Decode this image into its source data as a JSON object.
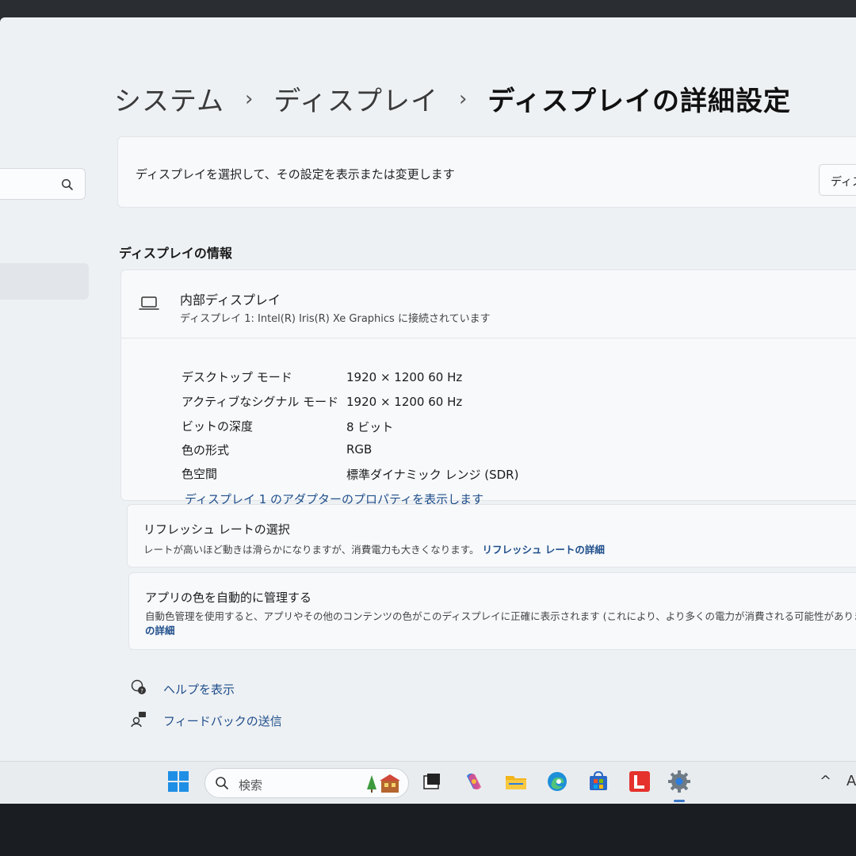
{
  "breadcrumb": {
    "items": [
      "システム",
      "ディスプレイ"
    ],
    "current": "ディスプレイの詳細設定"
  },
  "select_display": {
    "text": "ディスプレイを選択して、その設定を表示または変更します",
    "dropdown_value": "ディス"
  },
  "display_info": {
    "section_title": "ディスプレイの情報",
    "name": "内部ディスプレイ",
    "subtitle": "ディスプレイ 1: Intel(R) Iris(R) Xe Graphics に接続されています",
    "properties": [
      {
        "label": "デスクトップ モード",
        "value": "1920 × 1200 60 Hz"
      },
      {
        "label": "アクティブなシグナル モード",
        "value": "1920 × 1200 60 Hz"
      },
      {
        "label": "ビットの深度",
        "value": "8 ビット"
      },
      {
        "label": "色の形式",
        "value": "RGB"
      },
      {
        "label": "色空間",
        "value": "標準ダイナミック レンジ (SDR)"
      }
    ],
    "adapter_link": "ディスプレイ 1 のアダプターのプロパティを表示します"
  },
  "refresh_rate": {
    "title": "リフレッシュ レートの選択",
    "description": "レートが高いほど動きは滑らかになりますが、消費電力も大きくなります。",
    "link": "リフレッシュ レートの詳細"
  },
  "auto_color": {
    "title": "アプリの色を自動的に管理する",
    "description": "自動色管理を使用すると、アプリやその他のコンテンツの色がこのディスプレイに正確に表示されます (これにより、より多くの電力が消費される可能性があります) 自",
    "description_cont": "の詳細"
  },
  "help_links": {
    "help": "ヘルプを表示",
    "feedback": "フィードバックの送信"
  },
  "taskbar": {
    "search_placeholder": "検索",
    "tray_chevron": "^",
    "tray_ime": "A"
  },
  "colors": {
    "accent_link": "#1f4e8a",
    "background": "#eef1f4",
    "card": "#f7f9fb"
  }
}
